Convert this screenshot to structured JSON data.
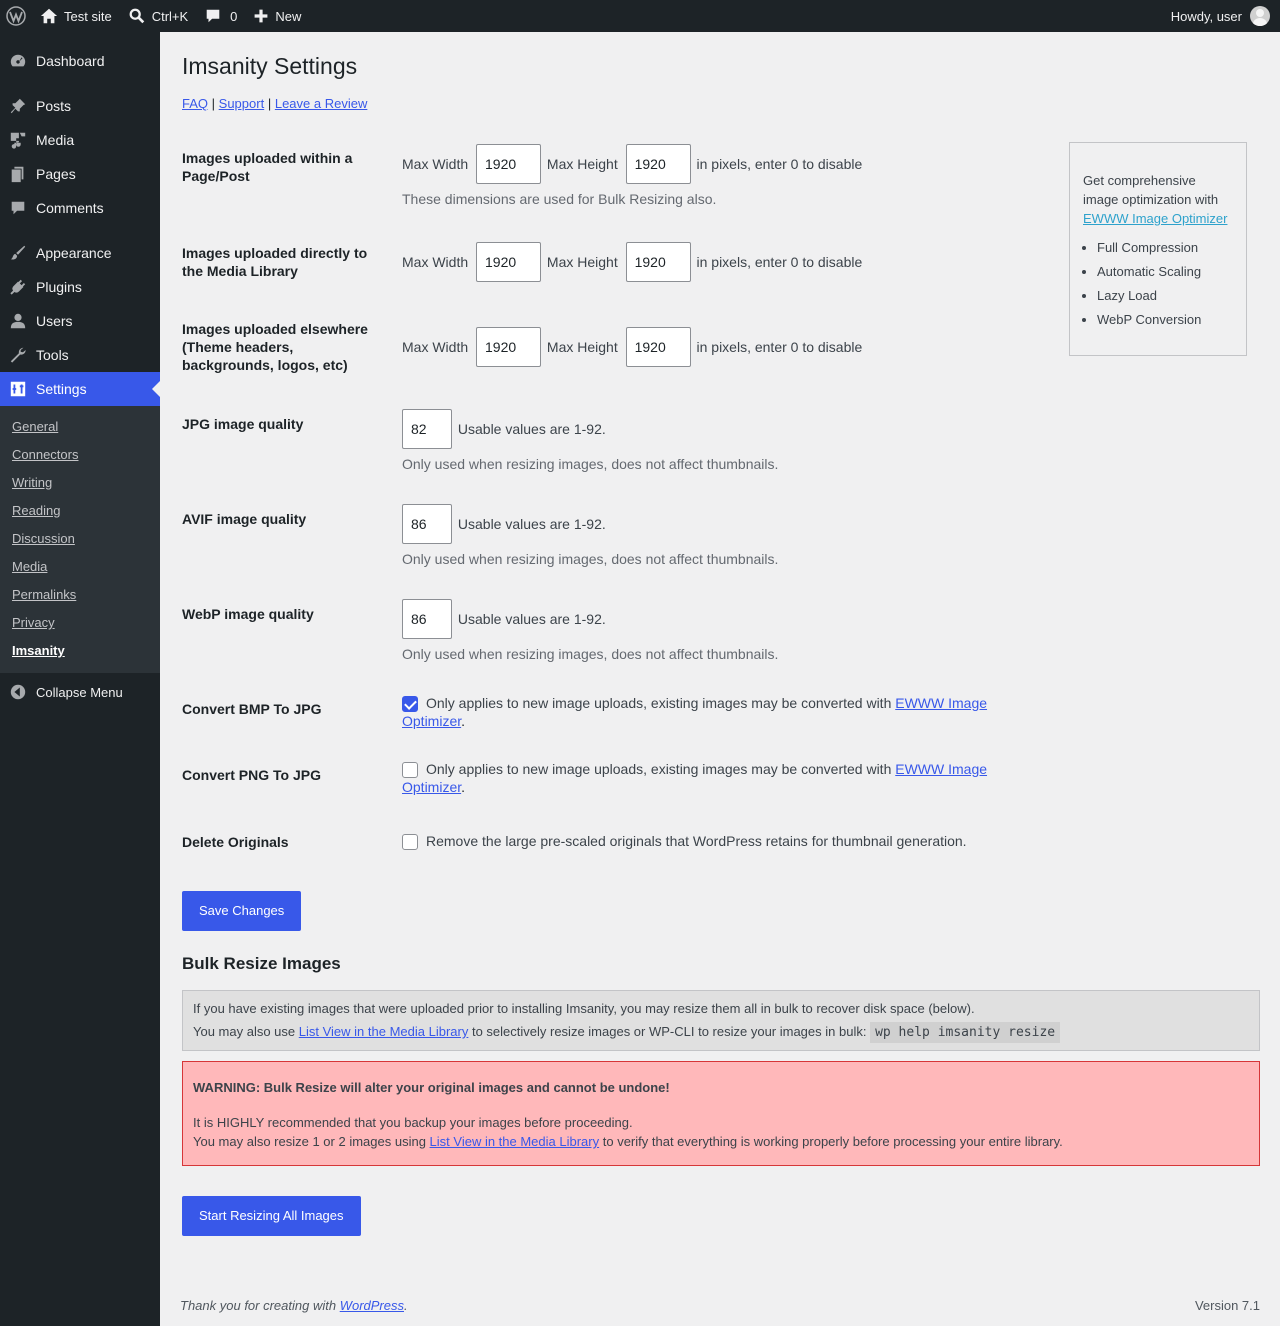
{
  "adminbar": {
    "site_name": "Test site",
    "search_shortcut": "Ctrl+K",
    "comments_count": "0",
    "new_label": "New",
    "howdy": "Howdy, user"
  },
  "sidebar": {
    "items": [
      {
        "label": "Dashboard",
        "icon": "dashboard-icon"
      },
      {
        "label": "Posts",
        "icon": "pin-icon"
      },
      {
        "label": "Media",
        "icon": "media-icon"
      },
      {
        "label": "Pages",
        "icon": "pages-icon"
      },
      {
        "label": "Comments",
        "icon": "comment-icon"
      },
      {
        "label": "Appearance",
        "icon": "brush-icon"
      },
      {
        "label": "Plugins",
        "icon": "plug-icon"
      },
      {
        "label": "Users",
        "icon": "user-icon"
      },
      {
        "label": "Tools",
        "icon": "wrench-icon"
      },
      {
        "label": "Settings",
        "icon": "sliders-icon"
      }
    ],
    "submenu": [
      "General",
      "Connectors",
      "Writing",
      "Reading",
      "Discussion",
      "Media",
      "Permalinks",
      "Privacy",
      "Imsanity"
    ],
    "collapse_label": "Collapse Menu"
  },
  "page": {
    "title": "Imsanity Settings",
    "links": {
      "faq": "FAQ",
      "sep": "|",
      "support": "Support",
      "review": "Leave a Review"
    }
  },
  "dims": {
    "max_width_label": "Max Width",
    "max_height_label": "Max Height",
    "hint": "in pixels, enter 0 to disable",
    "rows": [
      {
        "label": "Images uploaded within a Page/Post",
        "width": "1920",
        "height": "1920",
        "desc": "These dimensions are used for Bulk Resizing also."
      },
      {
        "label": "Images uploaded directly to the Media Library",
        "width": "1920",
        "height": "1920"
      },
      {
        "label": "Images uploaded elsewhere (Theme headers, backgrounds, logos, etc)",
        "width": "1920",
        "height": "1920"
      }
    ]
  },
  "quality": {
    "usable": "Usable values are 1-92.",
    "desc": "Only used when resizing images, does not affect thumbnails.",
    "rows": [
      {
        "label": "JPG image quality",
        "value": "82"
      },
      {
        "label": "AVIF image quality",
        "value": "86"
      },
      {
        "label": "WebP image quality",
        "value": "86"
      }
    ]
  },
  "convert": {
    "text": "Only applies to new image uploads, existing images may be converted with",
    "link": "EWWW Image Optimizer",
    "period": ".",
    "bmp": {
      "label": "Convert BMP To JPG",
      "checked": true
    },
    "png": {
      "label": "Convert PNG To JPG",
      "checked": false
    }
  },
  "delete": {
    "label": "Delete Originals",
    "text": "Remove the large pre-scaled originals that WordPress retains for thumbnail generation.",
    "checked": false
  },
  "save_label": "Save Changes",
  "sidebox": {
    "intro": "Get comprehensive image optimization with",
    "link": "EWWW Image Optimizer",
    "features": [
      "Full Compression",
      "Automatic Scaling",
      "Lazy Load",
      "WebP Conversion"
    ]
  },
  "bulk": {
    "title": "Bulk Resize Images",
    "info1": "If you have existing images that were uploaded prior to installing Imsanity, you may resize them all in bulk to recover disk space (below).",
    "info2_pre": "You may also use",
    "info2_link": "List View in the Media Library",
    "info2_post": "to selectively resize images or WP-CLI to resize your images in bulk:",
    "cli": "wp help imsanity resize",
    "warning": "WARNING: Bulk Resize will alter your original images and cannot be undone!",
    "backup": "It is HIGHLY recommended that you backup your images before proceeding.",
    "resize_pre": "You may also resize 1 or 2 images using",
    "resize_link": "List View in the Media Library",
    "resize_post": "to verify that everything is working properly before processing your entire library.",
    "start_label": "Start Resizing All Images"
  },
  "footer": {
    "thanks": "Thank you for creating with",
    "wp": "WordPress",
    "period": ".",
    "version": "Version 7.1"
  }
}
